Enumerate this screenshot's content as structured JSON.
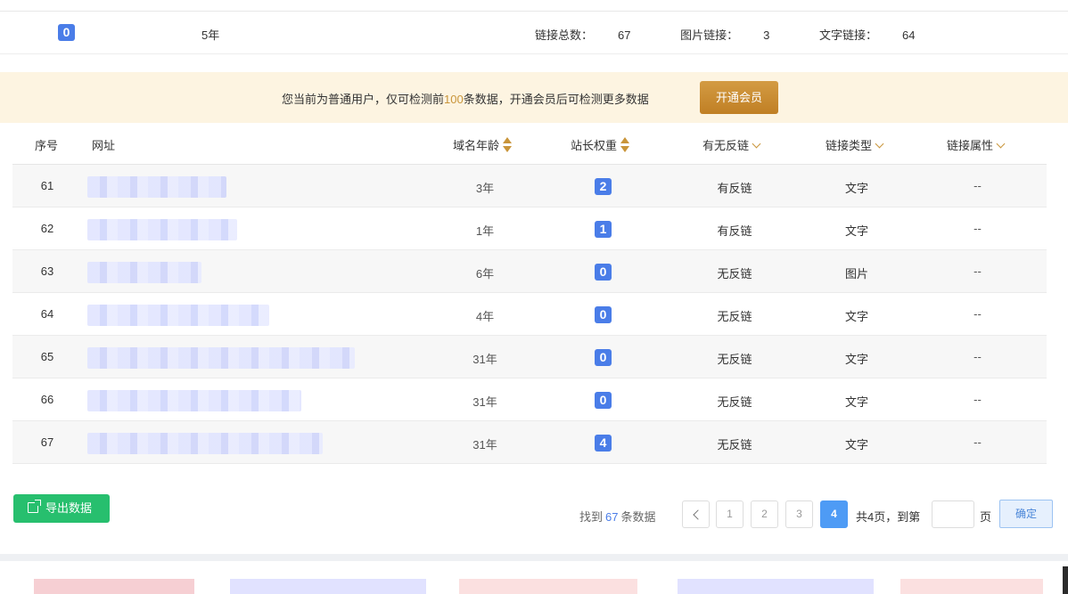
{
  "summary": {
    "weight": "0",
    "age": "5年",
    "stats": [
      {
        "label": "链接总数：",
        "value": "67"
      },
      {
        "label": "图片链接：",
        "value": "3"
      },
      {
        "label": "文字链接：",
        "value": "64"
      }
    ]
  },
  "promo": {
    "msg_pre": "您当前为普通用户，仅可检测前",
    "msg_num": "100",
    "msg_post": "条数据，开通会员后可检测更多数据",
    "button": "开通会员"
  },
  "table": {
    "headers": {
      "idx": "序号",
      "url": "网址",
      "age": "域名年龄",
      "weight": "站长权重",
      "backlink": "有无反链",
      "type": "链接类型",
      "attr": "链接属性"
    },
    "rows": [
      {
        "idx": "61",
        "age": "3年",
        "weight": "2",
        "backlink": "有反链",
        "type": "文字",
        "attr": "--"
      },
      {
        "idx": "62",
        "age": "1年",
        "weight": "1",
        "backlink": "有反链",
        "type": "文字",
        "attr": "--"
      },
      {
        "idx": "63",
        "age": "6年",
        "weight": "0",
        "backlink": "无反链",
        "type": "图片",
        "attr": "--"
      },
      {
        "idx": "64",
        "age": "4年",
        "weight": "0",
        "backlink": "无反链",
        "type": "文字",
        "attr": "--"
      },
      {
        "idx": "65",
        "age": "31年",
        "weight": "0",
        "backlink": "无反链",
        "type": "文字",
        "attr": "--"
      },
      {
        "idx": "66",
        "age": "31年",
        "weight": "0",
        "backlink": "无反链",
        "type": "文字",
        "attr": "--"
      },
      {
        "idx": "67",
        "age": "31年",
        "weight": "4",
        "backlink": "无反链",
        "type": "文字",
        "attr": "--"
      }
    ]
  },
  "export_button": "导出数据",
  "pagination": {
    "found_pre": "找到",
    "found_count": "67",
    "found_post": "条数据",
    "pages": [
      "1",
      "2",
      "3",
      "4"
    ],
    "current": "4",
    "total_text": "共4页，到第",
    "page_suffix": "页",
    "confirm": "确定"
  },
  "colors": {
    "accent": "#c9953a",
    "badge": "#4a7de8",
    "export": "#27bf6e",
    "active_page": "#4e9bf5"
  }
}
